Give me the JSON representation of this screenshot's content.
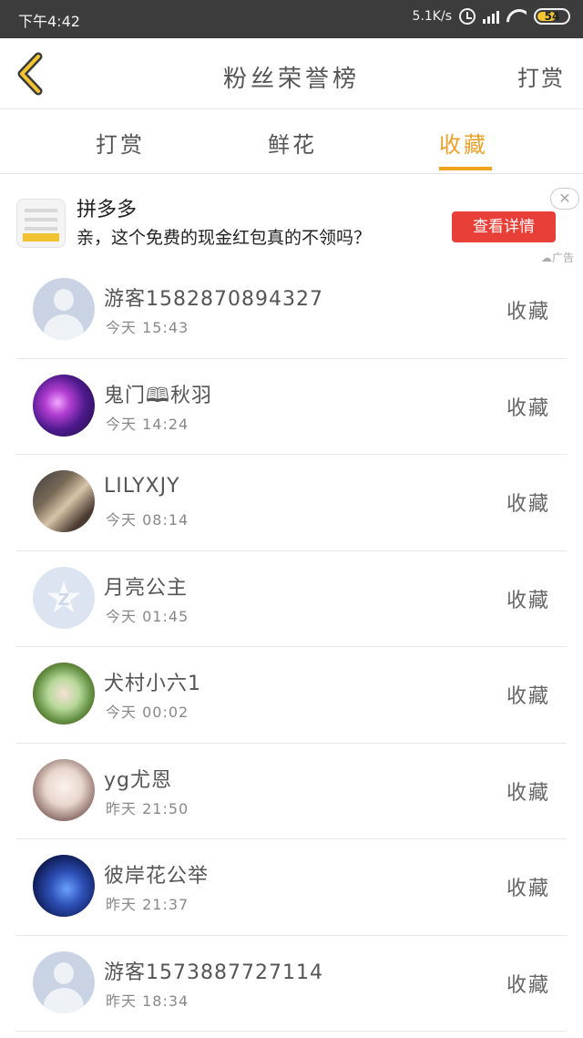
{
  "status_bar": {
    "time": "下午4:42",
    "network_speed": "5.1K/s",
    "battery": "54"
  },
  "header": {
    "title": "粉丝荣誉榜",
    "action": "打赏"
  },
  "tabs": [
    {
      "label": "打赏",
      "active": false
    },
    {
      "label": "鲜花",
      "active": false
    },
    {
      "label": "收藏",
      "active": true
    }
  ],
  "colors": {
    "accent": "#f0a21c",
    "ad_button": "#e84038",
    "status_bar": "#3c3c3c"
  },
  "ad": {
    "name": "拼多多",
    "description": "亲，这个免费的现金红包真的不领吗？",
    "button": "查看详情",
    "close": "✕",
    "tag": "☁广告"
  },
  "list": [
    {
      "name": "游客1582870894327",
      "time": "今天 15:43",
      "action": "收藏",
      "avatar": "default-avatar"
    },
    {
      "name": "鬼门🕮秋羽",
      "time": "今天 14:24",
      "action": "收藏",
      "avatar": "purple-avatar"
    },
    {
      "name": "LILYXJY",
      "time": "今天 08:14",
      "action": "收藏",
      "avatar": "anime-avatar"
    },
    {
      "name": "月亮公主",
      "time": "今天 01:45",
      "action": "收藏",
      "avatar": "qq-star-avatar"
    },
    {
      "name": "犬村小六1",
      "time": "今天 00:02",
      "action": "收藏",
      "avatar": "anime-green-avatar"
    },
    {
      "name": "yg尤恩",
      "time": "昨天 21:50",
      "action": "收藏",
      "avatar": "anime-white-avatar"
    },
    {
      "name": "彼岸花公举",
      "time": "昨天 21:37",
      "action": "收藏",
      "avatar": "space-avatar"
    },
    {
      "name": "游客1573887727114",
      "time": "昨天 18:34",
      "action": "收藏",
      "avatar": "default-avatar"
    }
  ]
}
